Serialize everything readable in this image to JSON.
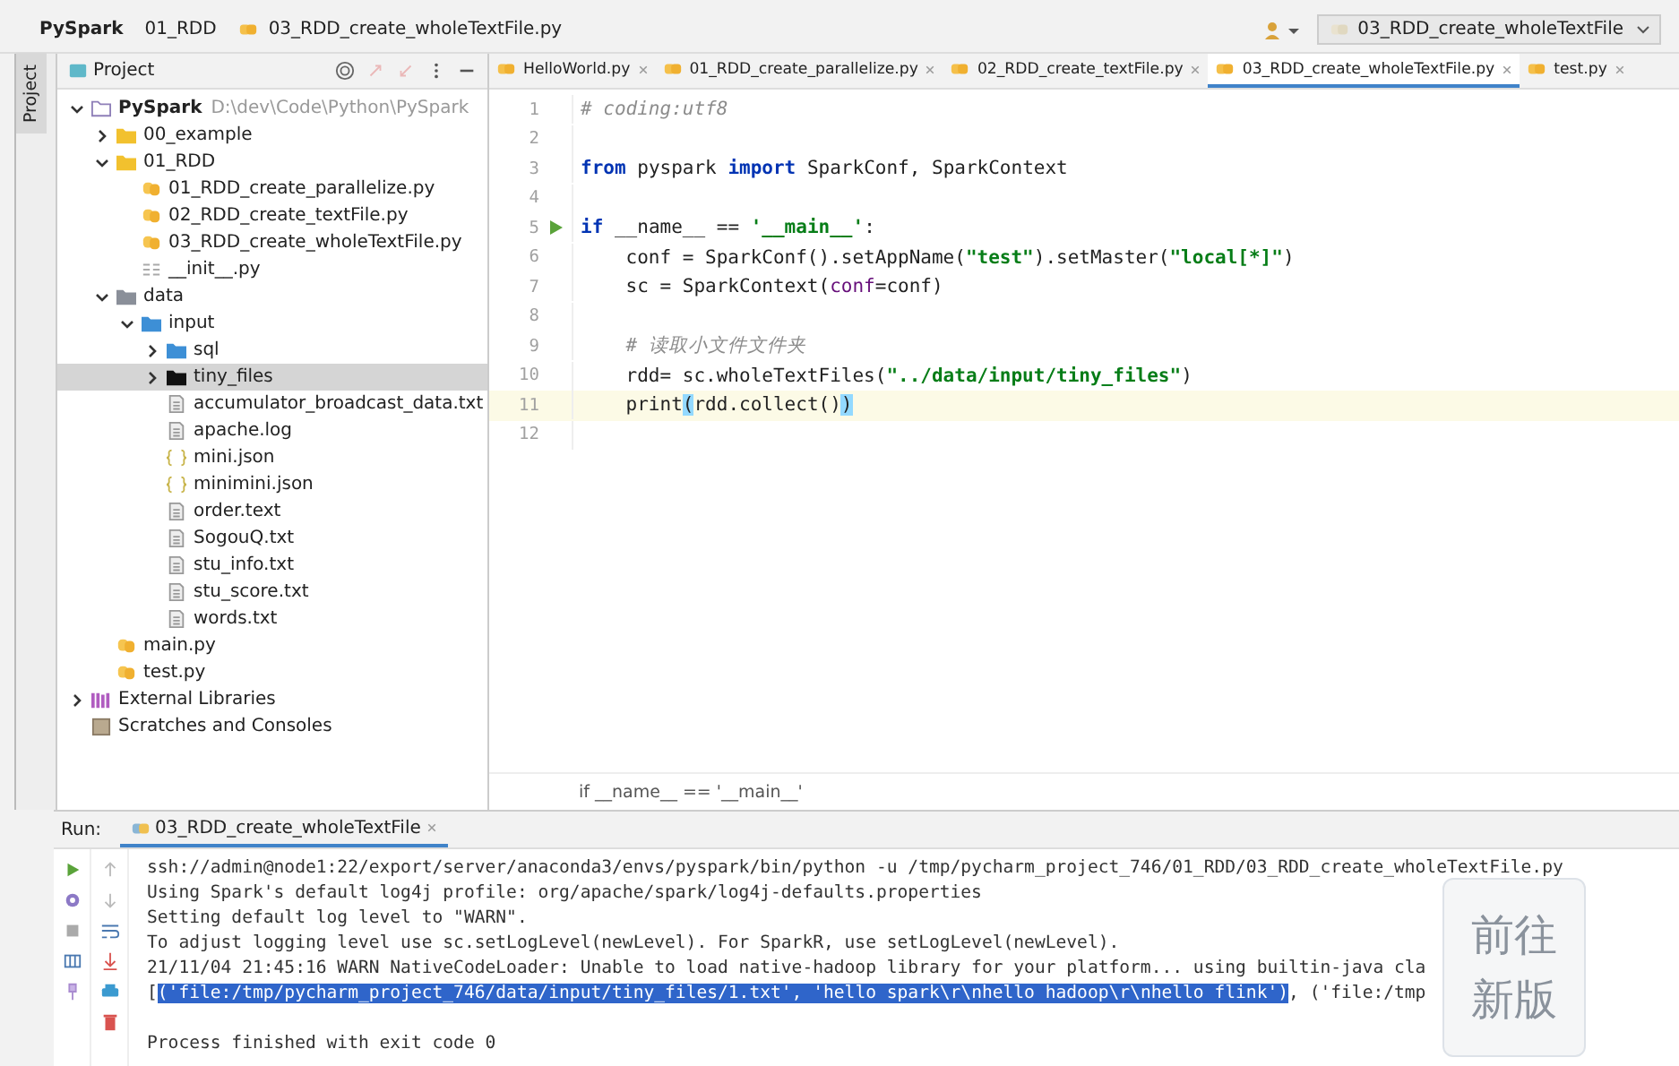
{
  "navbar": {
    "crumbs": [
      {
        "label": "PySpark",
        "kind": "project"
      },
      {
        "label": "01_RDD",
        "kind": "folder"
      },
      {
        "label": "03_RDD_create_wholeTextFile.py",
        "kind": "file-py"
      }
    ],
    "run_config": "03_RDD_create_wholeTextFile"
  },
  "tool_strip": {
    "label": "Project"
  },
  "project_panel": {
    "title": "Project",
    "tree": [
      {
        "label": "PySpark",
        "kind": "project",
        "path": "D:\\dev\\Code\\Python\\PySpark",
        "expanded": true,
        "selected": false,
        "children": [
          {
            "label": "00_example",
            "kind": "folder",
            "expanded": false,
            "selected": false
          },
          {
            "label": "01_RDD",
            "kind": "folder",
            "expanded": true,
            "selected": false,
            "children": [
              {
                "label": "01_RDD_create_parallelize.py",
                "kind": "file-py",
                "selected": false
              },
              {
                "label": "02_RDD_create_textFile.py",
                "kind": "file-py",
                "selected": false
              },
              {
                "label": "03_RDD_create_wholeTextFile.py",
                "kind": "file-py",
                "selected": false
              },
              {
                "label": "__init__.py",
                "kind": "file-init",
                "selected": false
              }
            ]
          },
          {
            "label": "data",
            "kind": "data-folder",
            "expanded": true,
            "selected": false,
            "children": [
              {
                "label": "input",
                "kind": "resource-folder",
                "expanded": true,
                "selected": false,
                "children": [
                  {
                    "label": "sql",
                    "kind": "resource-folder",
                    "expanded": false,
                    "selected": false
                  },
                  {
                    "label": "tiny_files",
                    "kind": "dark-folder",
                    "expanded": false,
                    "selected": true
                  },
                  {
                    "label": "accumulator_broadcast_data.txt",
                    "kind": "file-text",
                    "selected": false
                  },
                  {
                    "label": "apache.log",
                    "kind": "file-text",
                    "selected": false
                  },
                  {
                    "label": "mini.json",
                    "kind": "file-json",
                    "selected": false
                  },
                  {
                    "label": "minimini.json",
                    "kind": "file-json",
                    "selected": false
                  },
                  {
                    "label": "order.text",
                    "kind": "file-text",
                    "selected": false
                  },
                  {
                    "label": "SogouQ.txt",
                    "kind": "file-text",
                    "selected": false
                  },
                  {
                    "label": "stu_info.txt",
                    "kind": "file-text",
                    "selected": false
                  },
                  {
                    "label": "stu_score.txt",
                    "kind": "file-text",
                    "selected": false
                  },
                  {
                    "label": "words.txt",
                    "kind": "file-text",
                    "selected": false
                  }
                ]
              }
            ]
          },
          {
            "label": "main.py",
            "kind": "file-py",
            "selected": false
          },
          {
            "label": "test.py",
            "kind": "file-py",
            "selected": false
          }
        ]
      },
      {
        "label": "External Libraries",
        "kind": "library",
        "expanded": false,
        "selected": false
      },
      {
        "label": "Scratches and Consoles",
        "kind": "scratches",
        "selected": false
      }
    ]
  },
  "editor": {
    "tabs": [
      {
        "label": "HelloWorld.py",
        "selected": false
      },
      {
        "label": "01_RDD_create_parallelize.py",
        "selected": false
      },
      {
        "label": "02_RDD_create_textFile.py",
        "selected": false
      },
      {
        "label": "03_RDD_create_wholeTextFile.py",
        "selected": true
      },
      {
        "label": "test.py",
        "selected": false
      }
    ],
    "lines": [
      {
        "number": "1",
        "run_marker": false,
        "current": false,
        "tokens": [
          {
            "kind": "comment",
            "text": "# coding:utf8"
          }
        ]
      },
      {
        "number": "2",
        "run_marker": false,
        "current": false
      },
      {
        "number": "3",
        "run_marker": false,
        "current": false,
        "tokens": [
          {
            "kind": "keyword",
            "text": "from"
          },
          {
            "kind": "plain",
            "text": " pyspark "
          },
          {
            "kind": "keyword",
            "text": "import"
          },
          {
            "kind": "plain",
            "text": " SparkConf, SparkContext"
          }
        ]
      },
      {
        "number": "4",
        "run_marker": false,
        "current": false
      },
      {
        "number": "5",
        "run_marker": true,
        "current": false,
        "tokens": [
          {
            "kind": "keyword",
            "text": "if"
          },
          {
            "kind": "plain",
            "text": " __name__ == "
          },
          {
            "kind": "string",
            "text": "'__main__'"
          },
          {
            "kind": "plain",
            "text": ":"
          }
        ]
      },
      {
        "number": "6",
        "run_marker": false,
        "current": false,
        "tokens": [
          {
            "kind": "plain",
            "text": "    conf = SparkConf().setAppName("
          },
          {
            "kind": "string",
            "text": "\"test\""
          },
          {
            "kind": "plain",
            "text": ").setMaster("
          },
          {
            "kind": "string",
            "text": "\"local[*]\""
          },
          {
            "kind": "plain",
            "text": ")"
          }
        ]
      },
      {
        "number": "7",
        "run_marker": false,
        "current": false,
        "tokens": [
          {
            "kind": "plain",
            "text": "    sc = SparkContext("
          },
          {
            "kind": "param",
            "text": "conf"
          },
          {
            "kind": "plain",
            "text": "=conf)"
          }
        ]
      },
      {
        "number": "8",
        "run_marker": false,
        "current": false
      },
      {
        "number": "9",
        "run_marker": false,
        "current": false,
        "tokens": [
          {
            "kind": "comment",
            "text": "    # 读取小文件文件夹"
          }
        ]
      },
      {
        "number": "10",
        "run_marker": false,
        "current": false,
        "tokens": [
          {
            "kind": "plain",
            "text": "    rdd= sc.wholeTextFiles("
          },
          {
            "kind": "string",
            "text": "\"../data/input/tiny_files\""
          },
          {
            "kind": "plain",
            "text": ")"
          }
        ]
      },
      {
        "number": "11",
        "run_marker": false,
        "current": true,
        "tokens": [
          {
            "kind": "plain",
            "text": "    print"
          },
          {
            "kind": "match",
            "text": "("
          },
          {
            "kind": "plain",
            "text": "rdd.collect()"
          },
          {
            "kind": "match",
            "text": ")"
          }
        ]
      },
      {
        "number": "12",
        "run_marker": false,
        "current": false
      }
    ],
    "breadcrumb": "if __name__ == '__main__'"
  },
  "run_panel": {
    "label": "Run:",
    "tab": "03_RDD_create_wholeTextFile",
    "console": [
      {
        "segments": [
          {
            "text": "ssh://admin@node1:22/export/server/anaconda3/envs/pyspark/bin/python -u /tmp/pycharm_project_746/01_RDD/03_RDD_create_wholeTextFile.py",
            "selected": false
          }
        ]
      },
      {
        "segments": [
          {
            "text": "Using Spark's default log4j profile: org/apache/spark/log4j-defaults.properties",
            "selected": false
          }
        ]
      },
      {
        "segments": [
          {
            "text": "Setting default log level to \"WARN\".",
            "selected": false
          }
        ]
      },
      {
        "segments": [
          {
            "text": "To adjust logging level use sc.setLogLevel(newLevel). For SparkR, use setLogLevel(newLevel).",
            "selected": false
          }
        ]
      },
      {
        "segments": [
          {
            "text": "21/11/04 21:45:16 WARN NativeCodeLoader: Unable to load native-hadoop library for your platform... using builtin-java cla",
            "selected": false
          }
        ]
      },
      {
        "segments": [
          {
            "text": "[",
            "selected": false
          },
          {
            "text": "('file:/tmp/pycharm_project_746/data/input/tiny_files/1.txt', 'hello spark\\r\\nhello hadoop\\r\\nhello flink')",
            "selected": true
          },
          {
            "text": ", ('file:/tmp",
            "selected": false
          }
        ]
      },
      {
        "kind": "exit-status",
        "segments": [
          {
            "text": "Process finished with exit code 0",
            "selected": false
          }
        ]
      }
    ]
  },
  "overlay_button": {
    "label": "前往新版"
  }
}
